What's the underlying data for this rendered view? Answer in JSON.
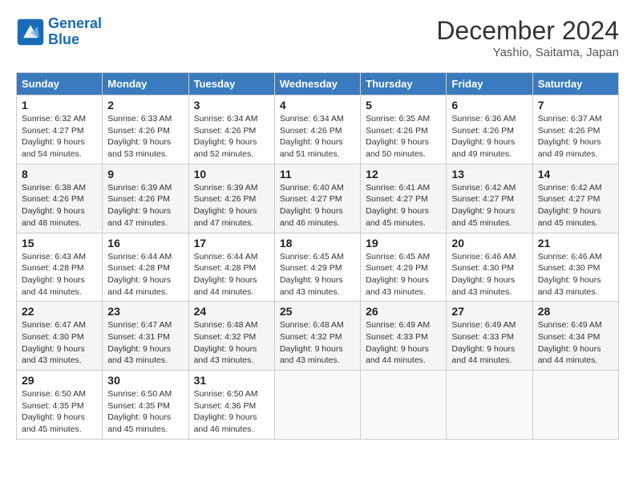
{
  "header": {
    "logo_line1": "General",
    "logo_line2": "Blue",
    "month": "December 2024",
    "location": "Yashio, Saitama, Japan"
  },
  "weekdays": [
    "Sunday",
    "Monday",
    "Tuesday",
    "Wednesday",
    "Thursday",
    "Friday",
    "Saturday"
  ],
  "weeks": [
    [
      {
        "day": "1",
        "sunrise": "Sunrise: 6:32 AM",
        "sunset": "Sunset: 4:27 PM",
        "daylight": "Daylight: 9 hours and 54 minutes."
      },
      {
        "day": "2",
        "sunrise": "Sunrise: 6:33 AM",
        "sunset": "Sunset: 4:26 PM",
        "daylight": "Daylight: 9 hours and 53 minutes."
      },
      {
        "day": "3",
        "sunrise": "Sunrise: 6:34 AM",
        "sunset": "Sunset: 4:26 PM",
        "daylight": "Daylight: 9 hours and 52 minutes."
      },
      {
        "day": "4",
        "sunrise": "Sunrise: 6:34 AM",
        "sunset": "Sunset: 4:26 PM",
        "daylight": "Daylight: 9 hours and 51 minutes."
      },
      {
        "day": "5",
        "sunrise": "Sunrise: 6:35 AM",
        "sunset": "Sunset: 4:26 PM",
        "daylight": "Daylight: 9 hours and 50 minutes."
      },
      {
        "day": "6",
        "sunrise": "Sunrise: 6:36 AM",
        "sunset": "Sunset: 4:26 PM",
        "daylight": "Daylight: 9 hours and 49 minutes."
      },
      {
        "day": "7",
        "sunrise": "Sunrise: 6:37 AM",
        "sunset": "Sunset: 4:26 PM",
        "daylight": "Daylight: 9 hours and 49 minutes."
      }
    ],
    [
      {
        "day": "8",
        "sunrise": "Sunrise: 6:38 AM",
        "sunset": "Sunset: 4:26 PM",
        "daylight": "Daylight: 9 hours and 48 minutes."
      },
      {
        "day": "9",
        "sunrise": "Sunrise: 6:39 AM",
        "sunset": "Sunset: 4:26 PM",
        "daylight": "Daylight: 9 hours and 47 minutes."
      },
      {
        "day": "10",
        "sunrise": "Sunrise: 6:39 AM",
        "sunset": "Sunset: 4:26 PM",
        "daylight": "Daylight: 9 hours and 47 minutes."
      },
      {
        "day": "11",
        "sunrise": "Sunrise: 6:40 AM",
        "sunset": "Sunset: 4:27 PM",
        "daylight": "Daylight: 9 hours and 46 minutes."
      },
      {
        "day": "12",
        "sunrise": "Sunrise: 6:41 AM",
        "sunset": "Sunset: 4:27 PM",
        "daylight": "Daylight: 9 hours and 45 minutes."
      },
      {
        "day": "13",
        "sunrise": "Sunrise: 6:42 AM",
        "sunset": "Sunset: 4:27 PM",
        "daylight": "Daylight: 9 hours and 45 minutes."
      },
      {
        "day": "14",
        "sunrise": "Sunrise: 6:42 AM",
        "sunset": "Sunset: 4:27 PM",
        "daylight": "Daylight: 9 hours and 45 minutes."
      }
    ],
    [
      {
        "day": "15",
        "sunrise": "Sunrise: 6:43 AM",
        "sunset": "Sunset: 4:28 PM",
        "daylight": "Daylight: 9 hours and 44 minutes."
      },
      {
        "day": "16",
        "sunrise": "Sunrise: 6:44 AM",
        "sunset": "Sunset: 4:28 PM",
        "daylight": "Daylight: 9 hours and 44 minutes."
      },
      {
        "day": "17",
        "sunrise": "Sunrise: 6:44 AM",
        "sunset": "Sunset: 4:28 PM",
        "daylight": "Daylight: 9 hours and 44 minutes."
      },
      {
        "day": "18",
        "sunrise": "Sunrise: 6:45 AM",
        "sunset": "Sunset: 4:29 PM",
        "daylight": "Daylight: 9 hours and 43 minutes."
      },
      {
        "day": "19",
        "sunrise": "Sunrise: 6:45 AM",
        "sunset": "Sunset: 4:29 PM",
        "daylight": "Daylight: 9 hours and 43 minutes."
      },
      {
        "day": "20",
        "sunrise": "Sunrise: 6:46 AM",
        "sunset": "Sunset: 4:30 PM",
        "daylight": "Daylight: 9 hours and 43 minutes."
      },
      {
        "day": "21",
        "sunrise": "Sunrise: 6:46 AM",
        "sunset": "Sunset: 4:30 PM",
        "daylight": "Daylight: 9 hours and 43 minutes."
      }
    ],
    [
      {
        "day": "22",
        "sunrise": "Sunrise: 6:47 AM",
        "sunset": "Sunset: 4:30 PM",
        "daylight": "Daylight: 9 hours and 43 minutes."
      },
      {
        "day": "23",
        "sunrise": "Sunrise: 6:47 AM",
        "sunset": "Sunset: 4:31 PM",
        "daylight": "Daylight: 9 hours and 43 minutes."
      },
      {
        "day": "24",
        "sunrise": "Sunrise: 6:48 AM",
        "sunset": "Sunset: 4:32 PM",
        "daylight": "Daylight: 9 hours and 43 minutes."
      },
      {
        "day": "25",
        "sunrise": "Sunrise: 6:48 AM",
        "sunset": "Sunset: 4:32 PM",
        "daylight": "Daylight: 9 hours and 43 minutes."
      },
      {
        "day": "26",
        "sunrise": "Sunrise: 6:49 AM",
        "sunset": "Sunset: 4:33 PM",
        "daylight": "Daylight: 9 hours and 44 minutes."
      },
      {
        "day": "27",
        "sunrise": "Sunrise: 6:49 AM",
        "sunset": "Sunset: 4:33 PM",
        "daylight": "Daylight: 9 hours and 44 minutes."
      },
      {
        "day": "28",
        "sunrise": "Sunrise: 6:49 AM",
        "sunset": "Sunset: 4:34 PM",
        "daylight": "Daylight: 9 hours and 44 minutes."
      }
    ],
    [
      {
        "day": "29",
        "sunrise": "Sunrise: 6:50 AM",
        "sunset": "Sunset: 4:35 PM",
        "daylight": "Daylight: 9 hours and 45 minutes."
      },
      {
        "day": "30",
        "sunrise": "Sunrise: 6:50 AM",
        "sunset": "Sunset: 4:35 PM",
        "daylight": "Daylight: 9 hours and 45 minutes."
      },
      {
        "day": "31",
        "sunrise": "Sunrise: 6:50 AM",
        "sunset": "Sunset: 4:36 PM",
        "daylight": "Daylight: 9 hours and 46 minutes."
      },
      null,
      null,
      null,
      null
    ]
  ]
}
